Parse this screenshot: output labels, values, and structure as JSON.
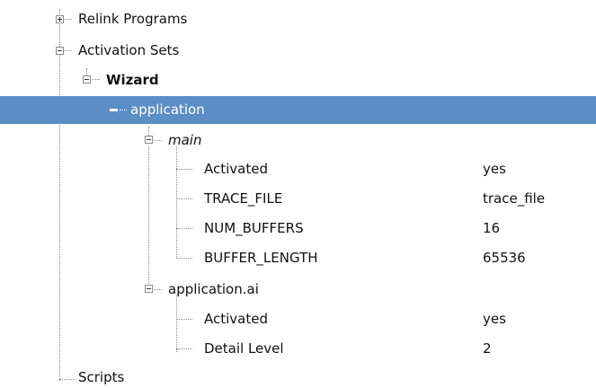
{
  "tree": {
    "relink_programs": {
      "label": "Relink Programs",
      "state": "collapsed"
    },
    "activation_sets": {
      "label": "Activation Sets",
      "state": "expanded"
    },
    "wizard": {
      "label": "Wizard",
      "state": "expanded"
    },
    "application": {
      "label": "application",
      "state": "expanded",
      "selected": true
    },
    "main": {
      "label": "main",
      "state": "expanded",
      "properties": [
        {
          "name": "Activated",
          "value": "yes"
        },
        {
          "name": "TRACE_FILE",
          "value": "trace_file"
        },
        {
          "name": "NUM_BUFFERS",
          "value": "16"
        },
        {
          "name": "BUFFER_LENGTH",
          "value": "65536"
        }
      ]
    },
    "application_ai": {
      "label": "application.ai",
      "state": "expanded",
      "properties": [
        {
          "name": "Activated",
          "value": "yes"
        },
        {
          "name": "Detail Level",
          "value": "2"
        }
      ]
    },
    "scripts": {
      "label": "Scripts"
    }
  },
  "colors": {
    "selection": "#5b8ec5",
    "tree_lines": "#8a8a8a"
  }
}
